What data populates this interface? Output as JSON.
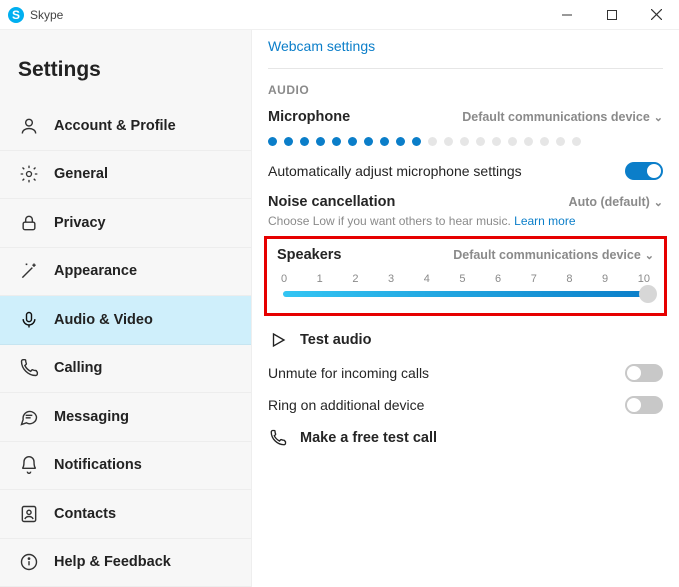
{
  "window": {
    "app_name": "Skype"
  },
  "sidebar": {
    "title": "Settings",
    "items": [
      {
        "label": "Account & Profile"
      },
      {
        "label": "General"
      },
      {
        "label": "Privacy"
      },
      {
        "label": "Appearance"
      },
      {
        "label": "Audio & Video"
      },
      {
        "label": "Calling"
      },
      {
        "label": "Messaging"
      },
      {
        "label": "Notifications"
      },
      {
        "label": "Contacts"
      },
      {
        "label": "Help & Feedback"
      }
    ],
    "active_index": 4
  },
  "main": {
    "webcam_link": "Webcam settings",
    "audio_section_label": "AUDIO",
    "microphone": {
      "heading": "Microphone",
      "device": "Default communications device",
      "level_on": 10,
      "level_total": 20
    },
    "auto_adjust": {
      "label": "Automatically adjust microphone settings",
      "on": true
    },
    "noise_cancel": {
      "heading": "Noise cancellation",
      "value": "Auto (default)",
      "subtext": "Choose Low if you want others to hear music.",
      "learn_more": "Learn more"
    },
    "speakers": {
      "heading": "Speakers",
      "device": "Default communications device",
      "ticks": [
        "0",
        "1",
        "2",
        "3",
        "4",
        "5",
        "6",
        "7",
        "8",
        "9",
        "10"
      ],
      "value": 10,
      "max": 10
    },
    "test_audio": "Test audio",
    "unmute": {
      "label": "Unmute for incoming calls",
      "on": false
    },
    "ring_additional": {
      "label": "Ring on additional device",
      "on": false
    },
    "free_test_call": "Make a free test call"
  }
}
